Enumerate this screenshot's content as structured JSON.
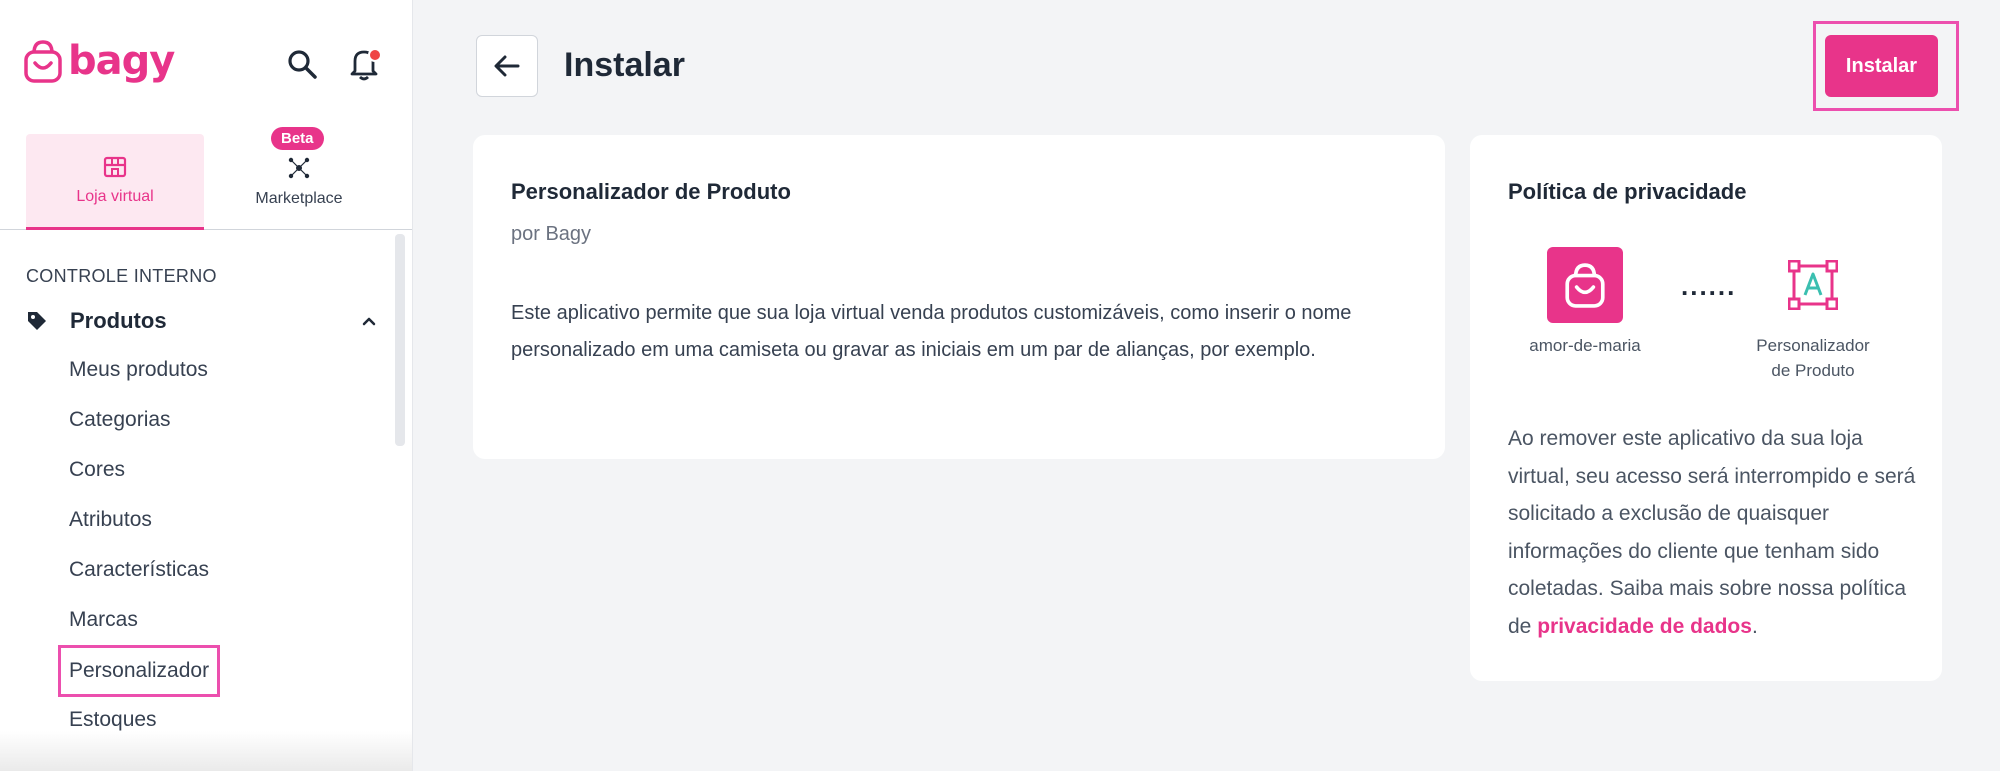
{
  "brand": {
    "name": "bagy",
    "color": "#e8348a"
  },
  "header": {
    "title": "Instalar",
    "install_label": "Instalar"
  },
  "sidebar": {
    "switch": {
      "active_label": "Loja virtual",
      "inactive_label": "Marketplace",
      "beta_badge": "Beta"
    },
    "section_title": "CONTROLE INTERNO",
    "group_label": "Produtos",
    "items": [
      {
        "label": "Meus produtos"
      },
      {
        "label": "Categorias"
      },
      {
        "label": "Cores"
      },
      {
        "label": "Atributos"
      },
      {
        "label": "Características"
      },
      {
        "label": "Marcas"
      },
      {
        "label": "Personalizador"
      },
      {
        "label": "Estoques"
      }
    ]
  },
  "app_card": {
    "title": "Personalizador de Produto",
    "author": "por Bagy",
    "description": "Este aplicativo permite que sua loja virtual venda produtos customizáveis, como inserir o nome personalizado em uma camiseta ou gravar as iniciais em um par de alianças, por exemplo."
  },
  "privacy_card": {
    "title": "Política de privacidade",
    "store_label": "amor-de-maria",
    "app_label": "Personalizador de Produto",
    "connector": "......",
    "text": "Ao remover este aplicativo da sua loja virtual, seu acesso será interrompido e será solicitado a exclusão de quaisquer informações do cliente que tenham sido coletadas. Saiba mais sobre nossa política de",
    "link_label": "privacidade de dados",
    "text_end": "."
  },
  "icons": {
    "search": "search-icon",
    "bell": "bell-icon",
    "store": "store-icon",
    "marketplace": "marketplace-icon",
    "tag": "tag-icon",
    "chevron": "chevron-up-icon",
    "back": "arrow-left-icon"
  }
}
